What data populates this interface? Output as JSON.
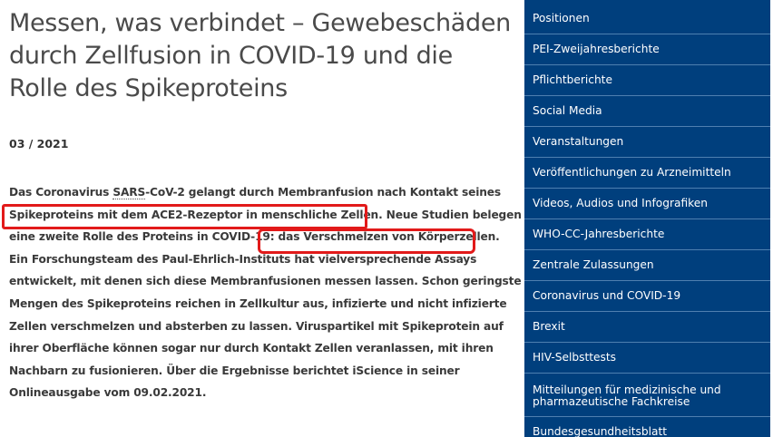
{
  "article": {
    "title": "Messen, was verbindet – Gewebeschäden durch Zellfusion in COVID-19 und die Rolle des Spikeproteins",
    "issue": "03 / 2021",
    "body": {
      "part1": "Das Coronavirus ",
      "abbr": "SARS",
      "part2": "-CoV-2 gelangt durch Membranfusion nach Kontakt seines Spikeproteins mit dem ACE2-Rezeptor in menschliche Zellen. Neue Studien belegen eine zweite Rolle des Proteins in COVID-19: das Verschmelzen von Körperzellen. Ein Forschungsteam des Paul-Ehrlich-Instituts hat vielversprechende Assays entwickelt, mit denen sich diese Membranfusionen messen lassen. Schon geringste Mengen des Spikeproteins reichen in Zellkultur aus, infizierte und nicht infizierte Zellen verschmelzen und absterben zu lassen. Viruspartikel mit Spikeprotein auf ihrer Oberfläche können sogar nur durch Kontakt Zellen veranlassen, mit ihren Nachbarn zu fusionieren. Über die Ergebnisse berichtet iScience in seiner Onlineausgabe vom 09.02.2021."
    }
  },
  "sidebar": {
    "items": [
      {
        "label": "Positionen"
      },
      {
        "label": "PEI-Zweijahresberichte"
      },
      {
        "label": "Pflichtberichte"
      },
      {
        "label": "Social Media"
      },
      {
        "label": "Veranstaltungen"
      },
      {
        "label": "Veröffentlichungen zu Arzneimitteln"
      },
      {
        "label": "Videos, Audios und Infografiken"
      },
      {
        "label": "WHO-CC-Jahresberichte"
      },
      {
        "label": "Zentrale Zulassungen"
      },
      {
        "label": "Coronavirus und COVID-19"
      },
      {
        "label": "Brexit"
      },
      {
        "label": "HIV-Selbsttests"
      },
      {
        "label": "Mitteilungen für medizinische und pharmazeutische Fachkreise"
      },
      {
        "label": "Bundesgesundheitsblatt"
      }
    ]
  },
  "colors": {
    "sidebar_background": "#003f7d",
    "sidebar_divider": "#4f7fb0",
    "highlight": "#e21a1a",
    "title_text": "#4a4a4a",
    "body_text": "#3a3a3a"
  }
}
